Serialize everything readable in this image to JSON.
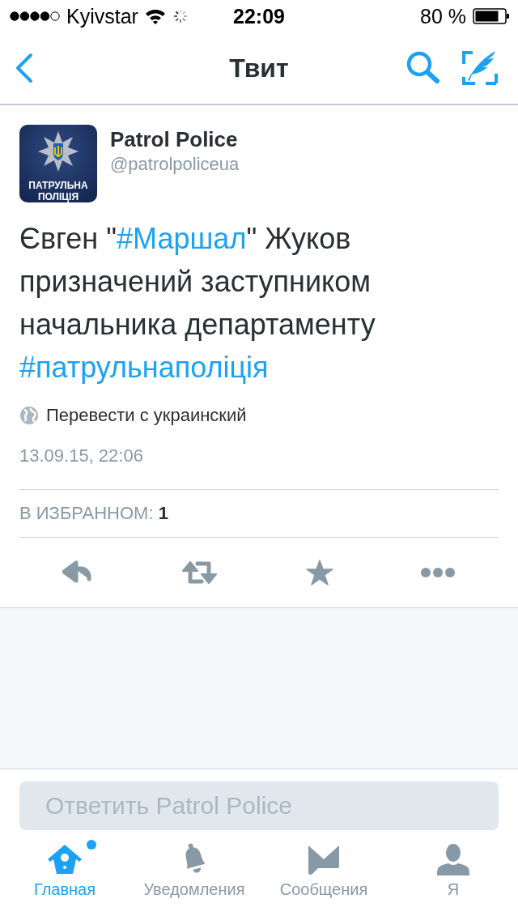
{
  "status_bar": {
    "carrier": "Kyivstar",
    "time": "22:09",
    "battery": "80 %"
  },
  "nav": {
    "title": "Твит"
  },
  "tweet": {
    "author": {
      "name": "Patrol Police",
      "handle": "@patrolpoliceua",
      "logo_text": [
        "ПАТРУЛЬНА",
        "ПОЛІЦІЯ"
      ]
    },
    "segments": [
      {
        "kind": "text",
        "text": "Євген \""
      },
      {
        "kind": "hashtag",
        "text": "#Маршал"
      },
      {
        "kind": "text",
        "text": "\" Жуков призначений заступником начальника департаменту "
      },
      {
        "kind": "hashtag",
        "text": "#патрульнаполіція"
      }
    ],
    "translate": "Перевести с украинский",
    "date": "13.09.15, 22:06",
    "stats": {
      "label": "В ИЗБРАННОМ:",
      "count": "1"
    },
    "actions": [
      {
        "kind": "reply"
      },
      {
        "kind": "retweet"
      },
      {
        "kind": "favorite"
      },
      {
        "kind": "more"
      }
    ]
  },
  "reply": {
    "placeholder": "Ответить Patrol Police"
  },
  "tab_bar": [
    {
      "kind": "home",
      "label": "Главная",
      "selected": true,
      "badge": true
    },
    {
      "kind": "notifications",
      "label": "Уведомления",
      "selected": false,
      "badge": false
    },
    {
      "kind": "messages",
      "label": "Сообщения",
      "selected": false,
      "badge": false
    },
    {
      "kind": "me",
      "label": "Я",
      "selected": false,
      "badge": false
    }
  ]
}
